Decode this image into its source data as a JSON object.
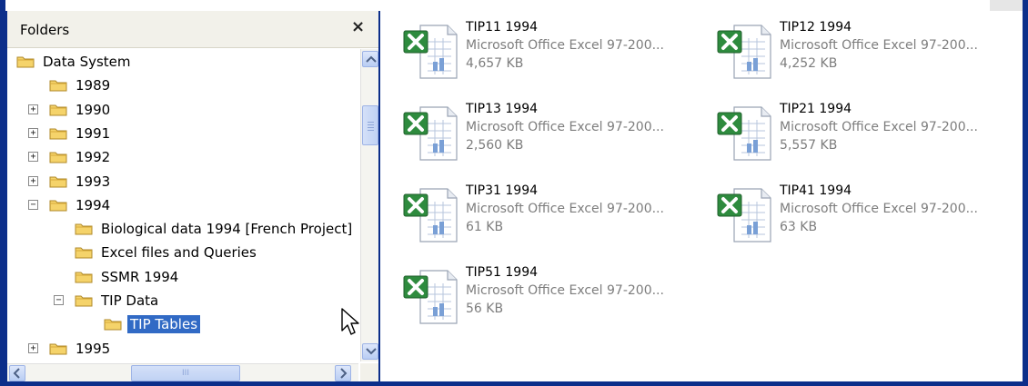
{
  "folders_pane": {
    "title": "Folders",
    "close_glyph": "×",
    "tree": [
      {
        "label": "Data System",
        "level": 0,
        "toggle": "",
        "selected": false
      },
      {
        "label": "1989",
        "level": 1,
        "toggle": "",
        "selected": false
      },
      {
        "label": "1990",
        "level": 1,
        "toggle": "+",
        "selected": false
      },
      {
        "label": "1991",
        "level": 1,
        "toggle": "+",
        "selected": false
      },
      {
        "label": "1992",
        "level": 1,
        "toggle": "+",
        "selected": false
      },
      {
        "label": "1993",
        "level": 1,
        "toggle": "+",
        "selected": false
      },
      {
        "label": "1994",
        "level": 1,
        "toggle": "−",
        "selected": false
      },
      {
        "label": "Biological data 1994 [French Project]",
        "level": 2,
        "toggle": "",
        "selected": false
      },
      {
        "label": "Excel files and Queries",
        "level": 2,
        "toggle": "",
        "selected": false
      },
      {
        "label": "SSMR 1994",
        "level": 2,
        "toggle": "",
        "selected": false
      },
      {
        "label": "TIP Data",
        "level": 2,
        "toggle": "−",
        "selected": false
      },
      {
        "label": "TIP Tables",
        "level": 3,
        "toggle": "",
        "selected": true
      },
      {
        "label": "1995",
        "level": 1,
        "toggle": "+",
        "selected": false
      }
    ],
    "hscroll_grip": "III"
  },
  "files": [
    {
      "name": "TIP11 1994",
      "type": "Microsoft Office Excel 97-200...",
      "size": "4,657 KB"
    },
    {
      "name": "TIP12 1994",
      "type": "Microsoft Office Excel 97-200...",
      "size": "4,252 KB"
    },
    {
      "name": "TIP13 1994",
      "type": "Microsoft Office Excel 97-200...",
      "size": "2,560 KB"
    },
    {
      "name": "TIP21 1994",
      "type": "Microsoft Office Excel 97-200...",
      "size": "5,557 KB"
    },
    {
      "name": "TIP31 1994",
      "type": "Microsoft Office Excel 97-200...",
      "size": "61 KB"
    },
    {
      "name": "TIP41 1994",
      "type": "Microsoft Office Excel 97-200...",
      "size": "63 KB"
    },
    {
      "name": "TIP51 1994",
      "type": "Microsoft Office Excel 97-200...",
      "size": "56 KB"
    }
  ],
  "icons": {
    "folder": "folder-icon",
    "file": "excel-file-icon",
    "close": "close-icon",
    "cursor": "mouse-pointer-icon"
  },
  "colors": {
    "selection": "#316ac5",
    "window_border": "#0c2e8a",
    "excel_green": "#2e8b3e",
    "folder_yellow": "#f5d36a"
  }
}
